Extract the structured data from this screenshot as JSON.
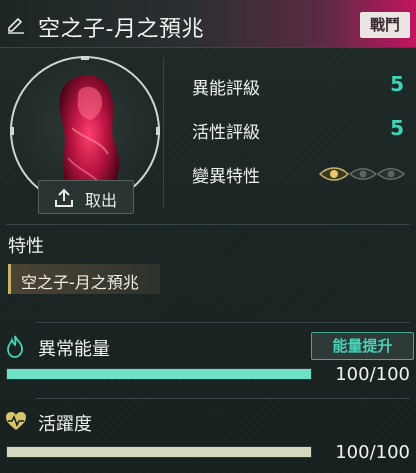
{
  "header": {
    "title": "空之子-月之預兆",
    "battle_tag": "戰鬥"
  },
  "portrait": {
    "take_out_label": "取出"
  },
  "stats": [
    {
      "label": "異能評級",
      "value": "5"
    },
    {
      "label": "活性評級",
      "value": "5"
    },
    {
      "label": "變異特性",
      "value": ""
    }
  ],
  "traits": {
    "section_title": "特性",
    "chip": "空之子-月之預兆"
  },
  "energy": {
    "title": "異常能量",
    "boost_label": "能量提升",
    "value_text": "100/100",
    "fill_fraction": 1.0
  },
  "vitality": {
    "title": "活躍度",
    "value_text": "100/100",
    "fill_fraction": 1.0
  },
  "mutation_eyes_active": 1,
  "colors": {
    "accent": "#3ed3b5",
    "energy_bar": "#6fe0c8",
    "vitality_bar": "#d7d9bf",
    "header_magenta": "#c2145f"
  }
}
